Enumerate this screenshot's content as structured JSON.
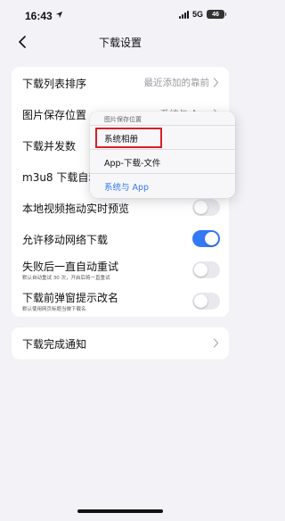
{
  "status_bar": {
    "time": "16:43",
    "network": "5G",
    "battery": "46"
  },
  "nav": {
    "title": "下载设置"
  },
  "settings": {
    "list_sort": {
      "label": "下载列表排序",
      "value": "最近添加的靠前"
    },
    "image_save": {
      "label": "图片保存位置",
      "value": "系统与 App"
    },
    "concurrency": {
      "label": "下载并发数"
    },
    "m3u8": {
      "label": "m3u8 下载自动"
    },
    "local_video": {
      "label": "本地视频拖动实时预览",
      "enabled": false
    },
    "mobile_network": {
      "label": "允许移动网络下载",
      "enabled": true
    },
    "auto_retry": {
      "label": "失败后一直自动重试",
      "sub": "默认自动重试 30 次，开启后将一直重试",
      "enabled": false
    },
    "rename_prompt": {
      "label": "下载前弹窗提示改名",
      "sub": "默认使用网页标题当做下载名",
      "enabled": false
    }
  },
  "notify": {
    "label": "下载完成通知"
  },
  "popup": {
    "title": "图片保存位置",
    "options": [
      {
        "label": "系统相册",
        "highlighted": true
      },
      {
        "label": "App-下载-文件"
      },
      {
        "label": "系统与 App",
        "selected": true
      }
    ]
  },
  "colors": {
    "accent": "#3478f6",
    "highlight": "#d8202a",
    "background": "#f2f2f7"
  }
}
